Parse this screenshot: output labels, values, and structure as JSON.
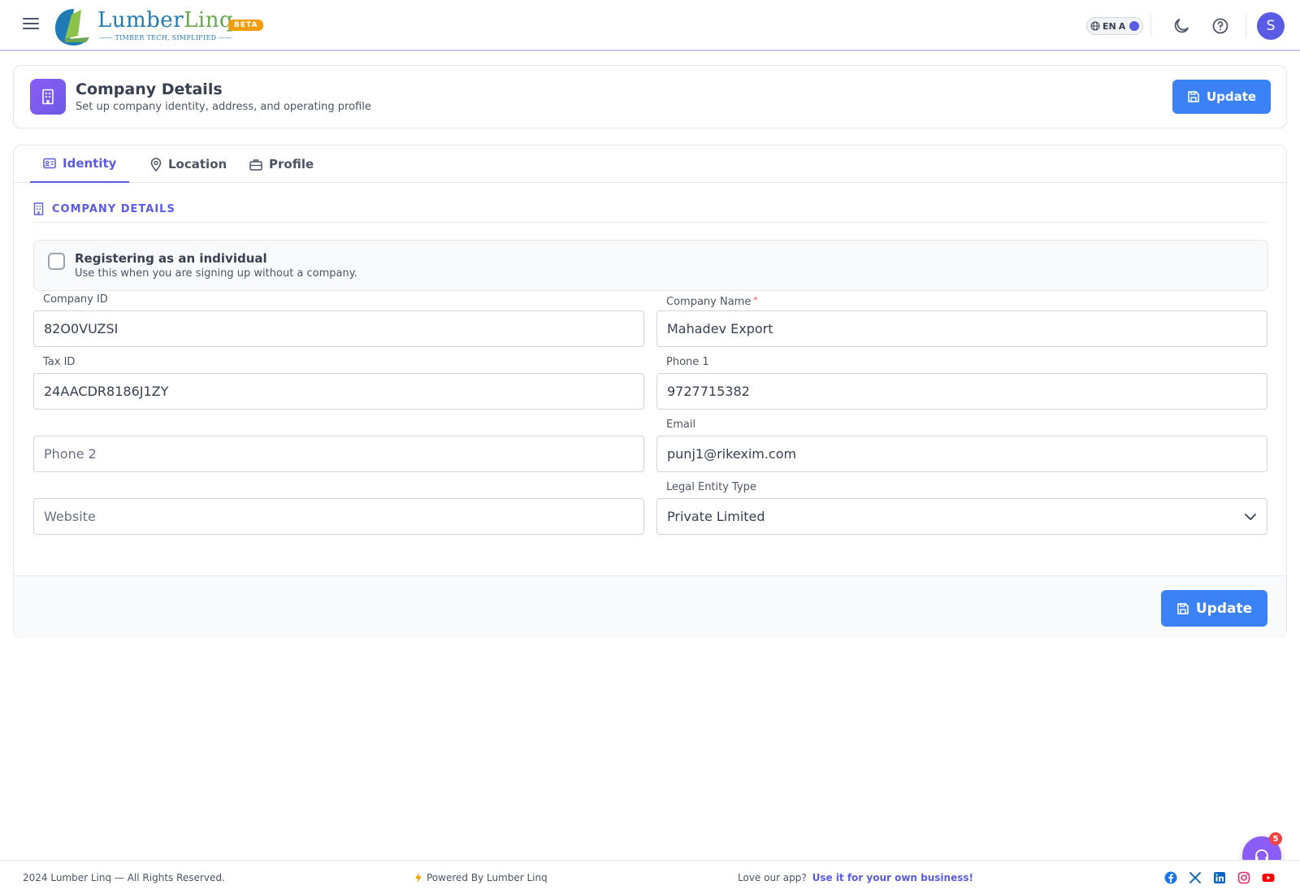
{
  "brand": {
    "name_part1": "Lumber",
    "name_part2": "Linq",
    "tagline": "—— TIMBER TECH, SIMPLIFIED ——",
    "badge": "BETA"
  },
  "topbar": {
    "language": "EN",
    "language_alt": "A",
    "avatar_initial": "S",
    "accent_color": "#5b5ce6"
  },
  "page": {
    "title": "Company Details",
    "subtitle": "Set up company identity, address, and operating profile",
    "update_label": "Update"
  },
  "tabs": [
    {
      "label": "Identity",
      "icon": "id-card-icon",
      "active": true
    },
    {
      "label": "Location",
      "icon": "map-pin-icon",
      "active": false
    },
    {
      "label": "Profile",
      "icon": "briefcase-icon",
      "active": false
    }
  ],
  "section": {
    "heading": "COMPANY DETAILS"
  },
  "individual": {
    "title": "Registering as an individual",
    "description": "Use this when you are signing up without a company.",
    "checked": false
  },
  "form": {
    "company_id": {
      "label": "Company ID",
      "value": "82O0VUZSI"
    },
    "company_name": {
      "label": "Company Name",
      "required_mark": "*",
      "value": "Mahadev Export"
    },
    "tax_id": {
      "label": "Tax ID",
      "value": "24AACDR8186J1ZY"
    },
    "phone1": {
      "label": "Phone 1",
      "value": "9727715382"
    },
    "phone2": {
      "placeholder": "Phone 2",
      "value": ""
    },
    "email": {
      "label": "Email",
      "value": "punj1@rikexim.com"
    },
    "website": {
      "placeholder": "Website",
      "value": ""
    },
    "legal_entity": {
      "label": "Legal Entity Type",
      "value": "Private Limited"
    }
  },
  "footer_action": {
    "update_label": "Update"
  },
  "footer": {
    "copyright": "2024 Lumber Linq — All Rights Reserved.",
    "powered": "Powered By Lumber Linq",
    "love_text": "Love our app?",
    "love_link": "Use it for your own business!",
    "social": [
      "facebook-icon",
      "x-icon",
      "linkedin-icon",
      "instagram-icon",
      "youtube-icon"
    ]
  },
  "support": {
    "notification_count": "5"
  }
}
